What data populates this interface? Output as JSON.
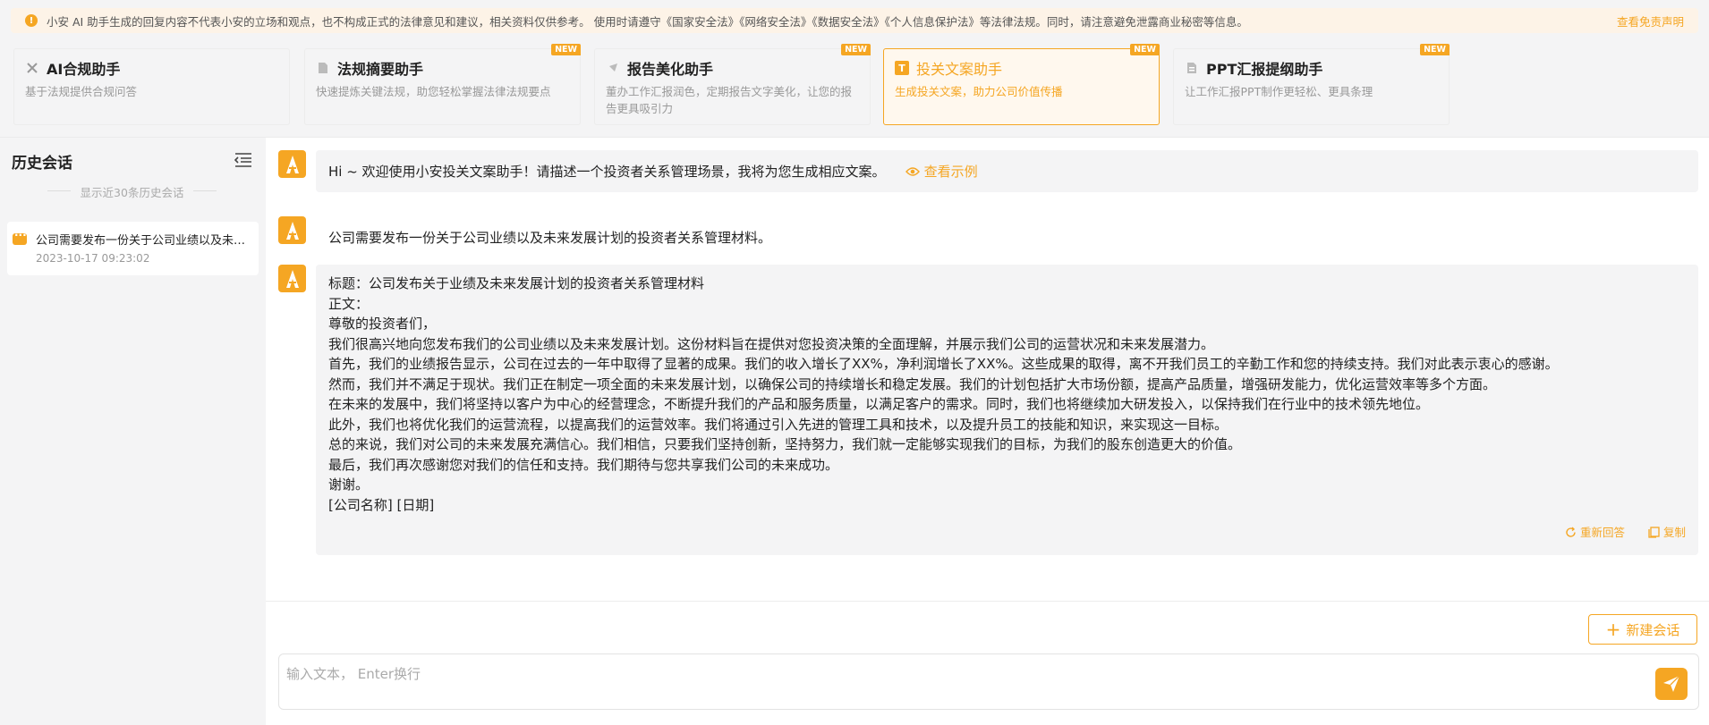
{
  "notice": {
    "text": "小安 AI 助手生成的回复内容不代表小安的立场和观点，也不构成正式的法律意见和建议，相关资料仅供参考。 使用时请遵守《国家安全法》《网络安全法》《数据安全法》《个人信息保护法》等法律法规。同时，请注意避免泄露商业秘密等信息。",
    "link": "查看免责声明"
  },
  "cards": [
    {
      "title": "AI合规助手",
      "desc": "基于法规提供合规问答",
      "badge": "",
      "icon": "tools-icon"
    },
    {
      "title": "法规摘要助手",
      "desc": "快速提炼关键法规，助您轻松掌握法律法规要点",
      "badge": "NEW",
      "icon": "document-icon"
    },
    {
      "title": "报告美化助手",
      "desc": "董办工作汇报润色，定期报告文字美化，让您的报告更具吸引力",
      "badge": "NEW",
      "icon": "brush-icon"
    },
    {
      "title": "投关文案助手",
      "desc": "生成投关文案，助力公司价值传播",
      "badge": "NEW",
      "icon": "text-icon"
    },
    {
      "title": "PPT汇报提纲助手",
      "desc": "让工作汇报PPT制作更轻松、更具条理",
      "badge": "NEW",
      "icon": "ppt-icon"
    }
  ],
  "sidebar": {
    "title": "历史会话",
    "subtitle": "显示近30条历史会话",
    "history": [
      {
        "title": "公司需要发布一份关于公司业绩以及未来发展计划的投资者关系管理材料。",
        "time": "2023-10-17 09:23:02"
      }
    ]
  },
  "chat": {
    "welcome": "Hi ~ 欢迎使用小安投关文案助手！请描述一个投资者关系管理场景，我将为您生成相应文案。",
    "example_link": "查看示例",
    "user_message": "公司需要发布一份关于公司业绩以及未来发展计划的投资者关系管理材料。",
    "answer_lines": [
      "标题：公司发布关于业绩及未来发展计划的投资者关系管理材料",
      "正文：",
      "尊敬的投资者们，",
      "我们很高兴地向您发布我们的公司业绩以及未来发展计划。这份材料旨在提供对您投资决策的全面理解，并展示我们公司的运营状况和未来发展潜力。",
      "首先，我们的业绩报告显示，公司在过去的一年中取得了显著的成果。我们的收入增长了XX%，净利润增长了XX%。这些成果的取得，离不开我们员工的辛勤工作和您的持续支持。我们对此表示衷心的感谢。",
      "然而，我们并不满足于现状。我们正在制定一项全面的未来发展计划，以确保公司的持续增长和稳定发展。我们的计划包括扩大市场份额，提高产品质量，增强研发能力，优化运营效率等多个方面。",
      "在未来的发展中，我们将坚持以客户为中心的经营理念，不断提升我们的产品和服务质量，以满足客户的需求。同时，我们也将继续加大研发投入，以保持我们在行业中的技术领先地位。",
      "此外，我们也将优化我们的运营流程，以提高我们的运营效率。我们将通过引入先进的管理工具和技术，以及提升员工的技能和知识，来实现这一目标。",
      "总的来说，我们对公司的未来发展充满信心。我们相信，只要我们坚持创新，坚持努力，我们就一定能够实现我们的目标，为我们的股东创造更大的价值。",
      "最后，我们再次感谢您对我们的信任和支持。我们期待与您共享我们公司的未来成功。",
      "谢谢。",
      "[公司名称] [日期]"
    ],
    "regenerate": "重新回答",
    "copy": "复制"
  },
  "composer": {
    "new_chat": "新建会话",
    "placeholder": "输入文本， Enter换行"
  },
  "colors": {
    "accent": "#f5a623",
    "bg": "#f4f4f5"
  }
}
